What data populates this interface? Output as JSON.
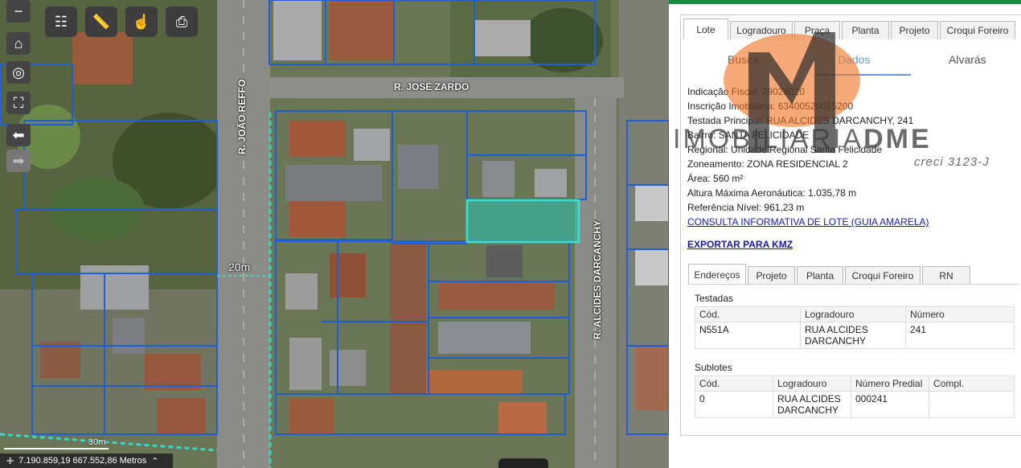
{
  "map": {
    "toolbar": [
      "layers-icon",
      "ruler-icon",
      "select-icon",
      "print-icon"
    ],
    "nav": [
      "zoom-out-icon",
      "home-icon",
      "locate-icon",
      "fullscreen-icon",
      "back-arrow-icon",
      "forward-arrow-icon"
    ],
    "roads": {
      "top": "R. JOSÉ ZARDO",
      "left": "R. JOÃO REFFO",
      "right": "R. ALCIDES DARCANCHY"
    },
    "scale_label": "20m",
    "scale_bar_label": "30m",
    "coordinates": "7.190.859,19 667.552,86 Metros"
  },
  "panel": {
    "main_tabs": [
      "Lote",
      "Logradouro",
      "Praça",
      "Planta",
      "Projeto",
      "Croqui Foreiro"
    ],
    "sub_tabs": [
      "Busca",
      "Dados",
      "Alvarás"
    ],
    "fields": [
      {
        "label": "Indicação Fiscal:",
        "value": "79028020"
      },
      {
        "label": "Inscrição Imobiliária:",
        "value": "63400520015200"
      },
      {
        "label": "Testada Principal:",
        "value": "RUA ALCIDES DARCANCHY, 241"
      },
      {
        "label": "Bairro:",
        "value": "SANTA FELICIDADE"
      },
      {
        "label": "Regional:",
        "value": "Unidade Regional Santa Felicidade"
      },
      {
        "label": "Zoneamento:",
        "value": "ZONA RESIDENCIAL 2"
      },
      {
        "label": "Área:",
        "value": "560 m²"
      },
      {
        "label": "Altura Máxima Aeronáutica:",
        "value": "1.035,78 m"
      },
      {
        "label": "Referência Nível:",
        "value": "961,23 m"
      }
    ],
    "consult_link": "CONSULTA INFORMATIVA DE LOTE (GUIA AMARELA)",
    "export_link": "EXPORTAR PARA KMZ",
    "detail_tabs": [
      "Endereços",
      "Projeto",
      "Planta",
      "Croqui Foreiro",
      "RN"
    ],
    "testadas": {
      "title": "Testadas",
      "headers": [
        "Cód.",
        "Logradouro",
        "Número"
      ],
      "rows": [
        [
          "N551A",
          "RUA ALCIDES DARCANCHY",
          "241"
        ]
      ]
    },
    "sublotes": {
      "title": "Sublotes",
      "headers": [
        "Cód.",
        "Logradouro",
        "Número Predial",
        "Compl."
      ],
      "rows": [
        [
          "0",
          "RUA ALCIDES DARCANCHY",
          "000241",
          ""
        ]
      ]
    }
  },
  "watermark": {
    "brand": "IMOBILIARIA",
    "brand_suffix": "DME",
    "creci": "creci 3123-J"
  }
}
